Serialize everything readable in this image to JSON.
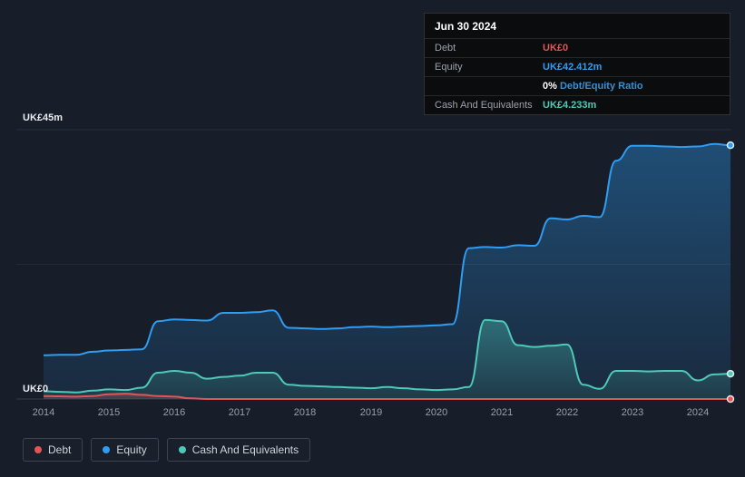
{
  "tooltip": {
    "date": "Jun 30 2024",
    "debt_label": "Debt",
    "debt_value": "UK£0",
    "equity_label": "Equity",
    "equity_value": "UK£42.412m",
    "ratio_value": "0%",
    "ratio_label": "Debt/Equity Ratio",
    "cash_label": "Cash And Equivalents",
    "cash_value": "UK£4.233m"
  },
  "axis": {
    "y_top_label": "UK£45m",
    "y_bottom_label": "UK£0"
  },
  "legend": {
    "items": [
      {
        "label": "Debt",
        "color": "#e25555"
      },
      {
        "label": "Equity",
        "color": "#2e9df2"
      },
      {
        "label": "Cash And Equivalents",
        "color": "#4ec9b8"
      }
    ]
  },
  "colors": {
    "background": "#171d29",
    "tooltip_background": "#0b0c0e",
    "grid": "#262e3c",
    "debt": "#e25555",
    "equity": "#2e9df2",
    "cash": "#4ec9b8"
  },
  "chart_data": {
    "type": "area",
    "title": "",
    "xlabel": "",
    "ylabel": "",
    "ylim": [
      0,
      45
    ],
    "y_tick_labels": [
      "UK£0",
      "UK£45m"
    ],
    "x_ticks": [
      2014,
      2015,
      2016,
      2017,
      2018,
      2019,
      2020,
      2021,
      2022,
      2023,
      2024
    ],
    "grid": true,
    "legend_position": "bottom",
    "x": [
      2014,
      2014.25,
      2014.5,
      2014.75,
      2015,
      2015.25,
      2015.5,
      2015.75,
      2016,
      2016.25,
      2016.5,
      2016.75,
      2017,
      2017.25,
      2017.5,
      2017.75,
      2018,
      2018.25,
      2018.5,
      2018.75,
      2019,
      2019.25,
      2019.5,
      2019.75,
      2020,
      2020.25,
      2020.5,
      2020.75,
      2021,
      2021.25,
      2021.5,
      2021.75,
      2022,
      2022.25,
      2022.5,
      2022.75,
      2023,
      2023.25,
      2023.5,
      2023.75,
      2024,
      2024.25,
      2024.5
    ],
    "series": [
      {
        "name": "Debt",
        "color": "#e25555",
        "final_label": "UK£0",
        "values": [
          0.5,
          0.45,
          0.4,
          0.5,
          0.8,
          0.9,
          0.7,
          0.5,
          0.4,
          0.1,
          0,
          0,
          0,
          0,
          0,
          0,
          0,
          0,
          0,
          0,
          0,
          0,
          0,
          0,
          0,
          0,
          0,
          0,
          0,
          0,
          0,
          0,
          0,
          0,
          0,
          0,
          0,
          0,
          0,
          0,
          0,
          0,
          0
        ]
      },
      {
        "name": "Equity",
        "color": "#2e9df2",
        "final_label": "UK£42.412m",
        "values": [
          7.3,
          7.4,
          7.4,
          7.9,
          8.1,
          8.2,
          8.3,
          13.0,
          13.3,
          13.2,
          13.1,
          14.4,
          14.4,
          14.5,
          14.8,
          11.9,
          11.8,
          11.7,
          11.8,
          12.0,
          12.1,
          12.0,
          12.1,
          12.2,
          12.3,
          12.5,
          25.2,
          25.4,
          25.3,
          25.7,
          25.6,
          30.2,
          30.0,
          30.6,
          30.4,
          39.8,
          42.3,
          42.3,
          42.2,
          42.1,
          42.2,
          42.6,
          42.412
        ]
      },
      {
        "name": "Cash And Equivalents",
        "color": "#4ec9b8",
        "final_label": "UK£4.233m",
        "values": [
          1.3,
          1.2,
          1.1,
          1.4,
          1.6,
          1.5,
          1.9,
          4.4,
          4.7,
          4.4,
          3.4,
          3.7,
          3.9,
          4.4,
          4.4,
          2.4,
          2.2,
          2.1,
          2.0,
          1.9,
          1.8,
          2.0,
          1.8,
          1.6,
          1.5,
          1.6,
          2.0,
          13.2,
          13.0,
          9.0,
          8.7,
          8.9,
          9.1,
          2.4,
          1.7,
          4.7,
          4.7,
          4.6,
          4.7,
          4.7,
          3.1,
          4.1,
          4.233
        ]
      }
    ]
  }
}
